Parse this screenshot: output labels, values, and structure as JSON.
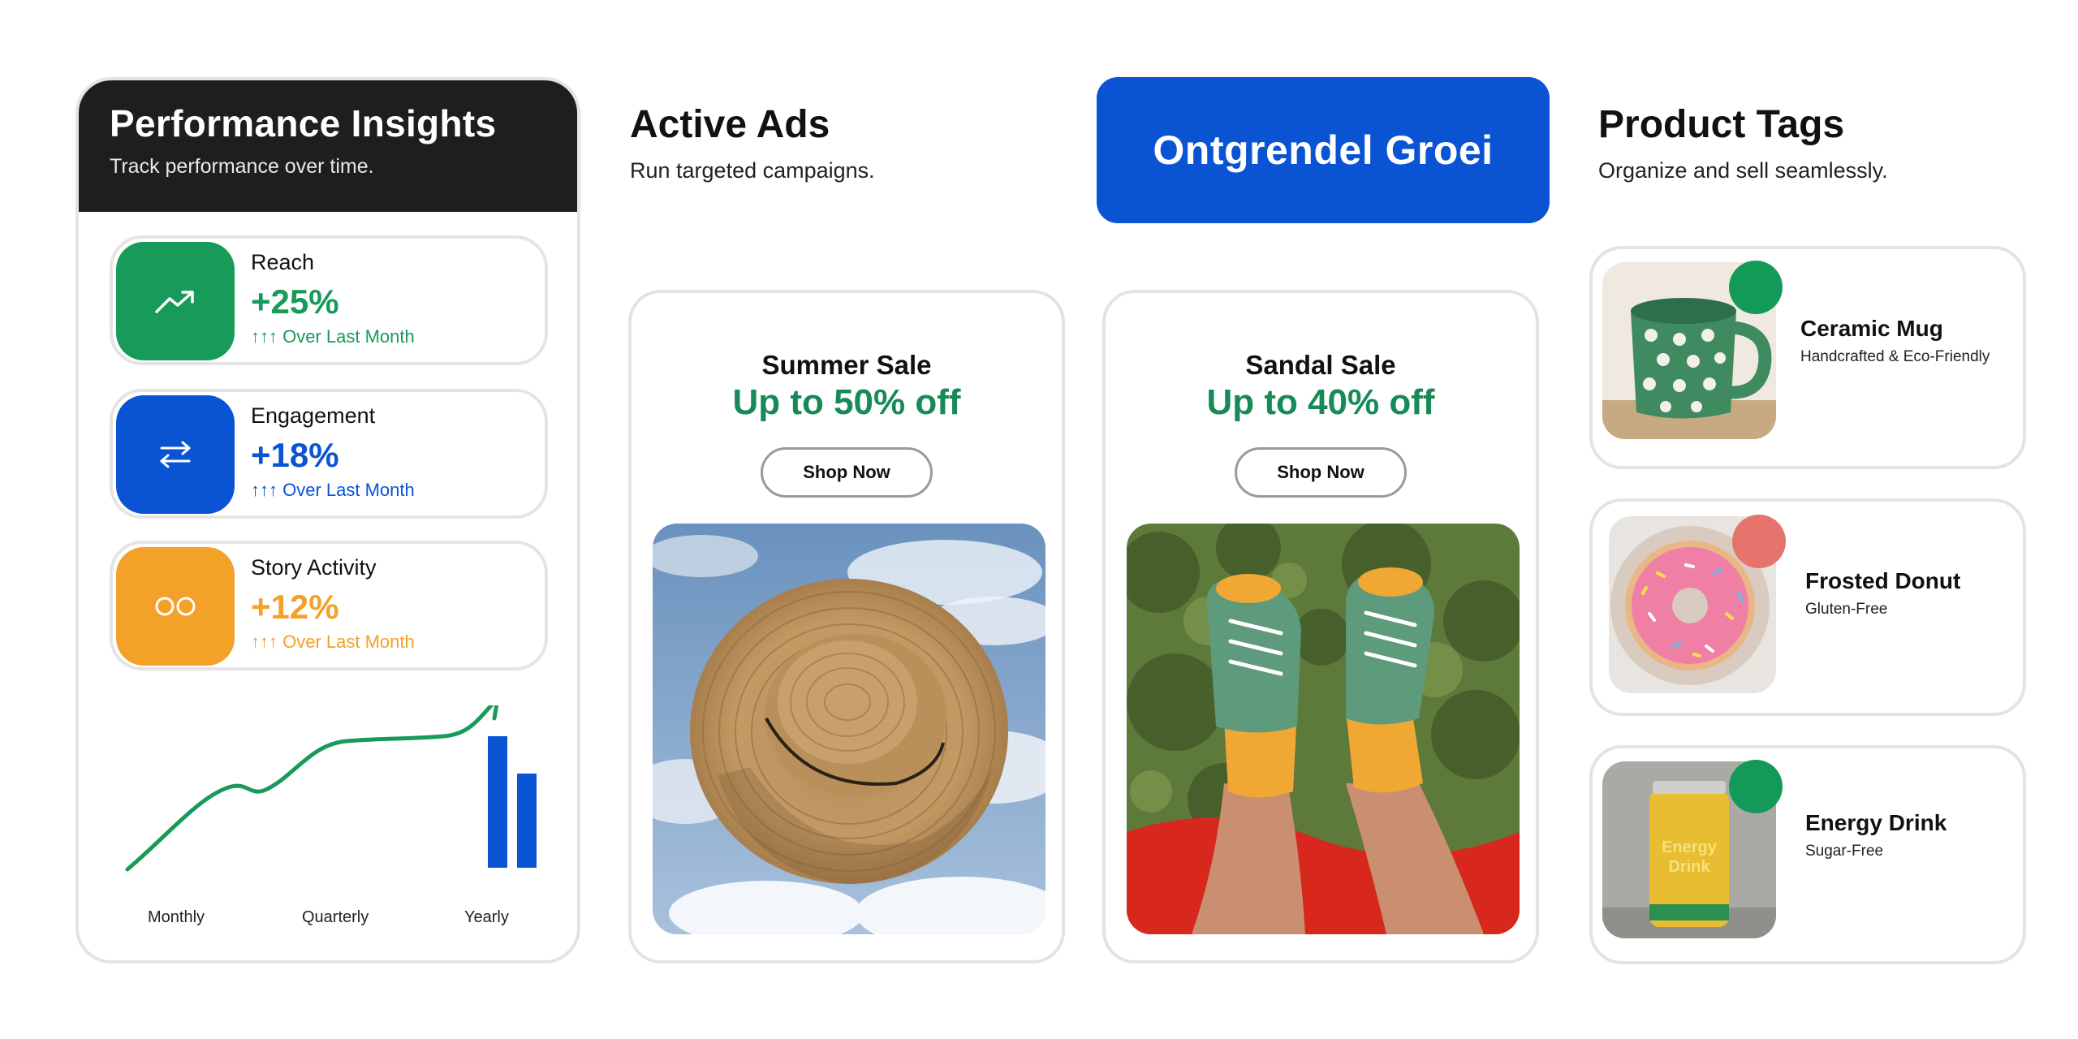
{
  "performance": {
    "title": "Performance Insights",
    "subtitle": "Track performance over time.",
    "metrics": [
      {
        "label": "Reach",
        "value": "+25%",
        "trend": "↑↑↑ Over Last Month",
        "color": "#179a5a",
        "icon": "trend-up-icon"
      },
      {
        "label": "Engagement",
        "value": "+18%",
        "trend": "↑↑↑ Over Last Month",
        "color": "#0a54d4",
        "icon": "swap-arrows-icon"
      },
      {
        "label": "Story Activity",
        "value": "+12%",
        "trend": "↑↑↑ Over Last Month",
        "color": "#f4a12a",
        "icon": "double-circle-icon"
      }
    ],
    "chart_labels": [
      "Monthly",
      "Quarterly",
      "Yearly"
    ]
  },
  "active_ads": {
    "title": "Active Ads",
    "subtitle": "Run targeted campaigns.",
    "ads": [
      {
        "name": "Summer Sale",
        "discount": "Up to 50% off",
        "button": "Shop Now",
        "image": "straw-hat"
      },
      {
        "name": "Sandal Sale",
        "discount": "Up to 40% off",
        "button": "Shop Now",
        "image": "green-sneakers"
      }
    ]
  },
  "cta": {
    "label": "Ontgrendel Groei",
    "color": "#0a54d4"
  },
  "product_tags": {
    "title": "Product Tags",
    "subtitle": "Organize and sell seamlessly.",
    "products": [
      {
        "name": "Ceramic Mug",
        "desc": "Handcrafted & Eco-Friendly",
        "dot_color": "#149a58",
        "image": "polka-dot-mug"
      },
      {
        "name": "Frosted Donut",
        "desc": "Gluten-Free",
        "dot_color": "#e6736c",
        "image": "pink-donut"
      },
      {
        "name": "Energy Drink",
        "desc": "Sugar-Free",
        "dot_color": "#149a58",
        "image": "energy-can",
        "can_text": "Energy Drink"
      }
    ]
  }
}
